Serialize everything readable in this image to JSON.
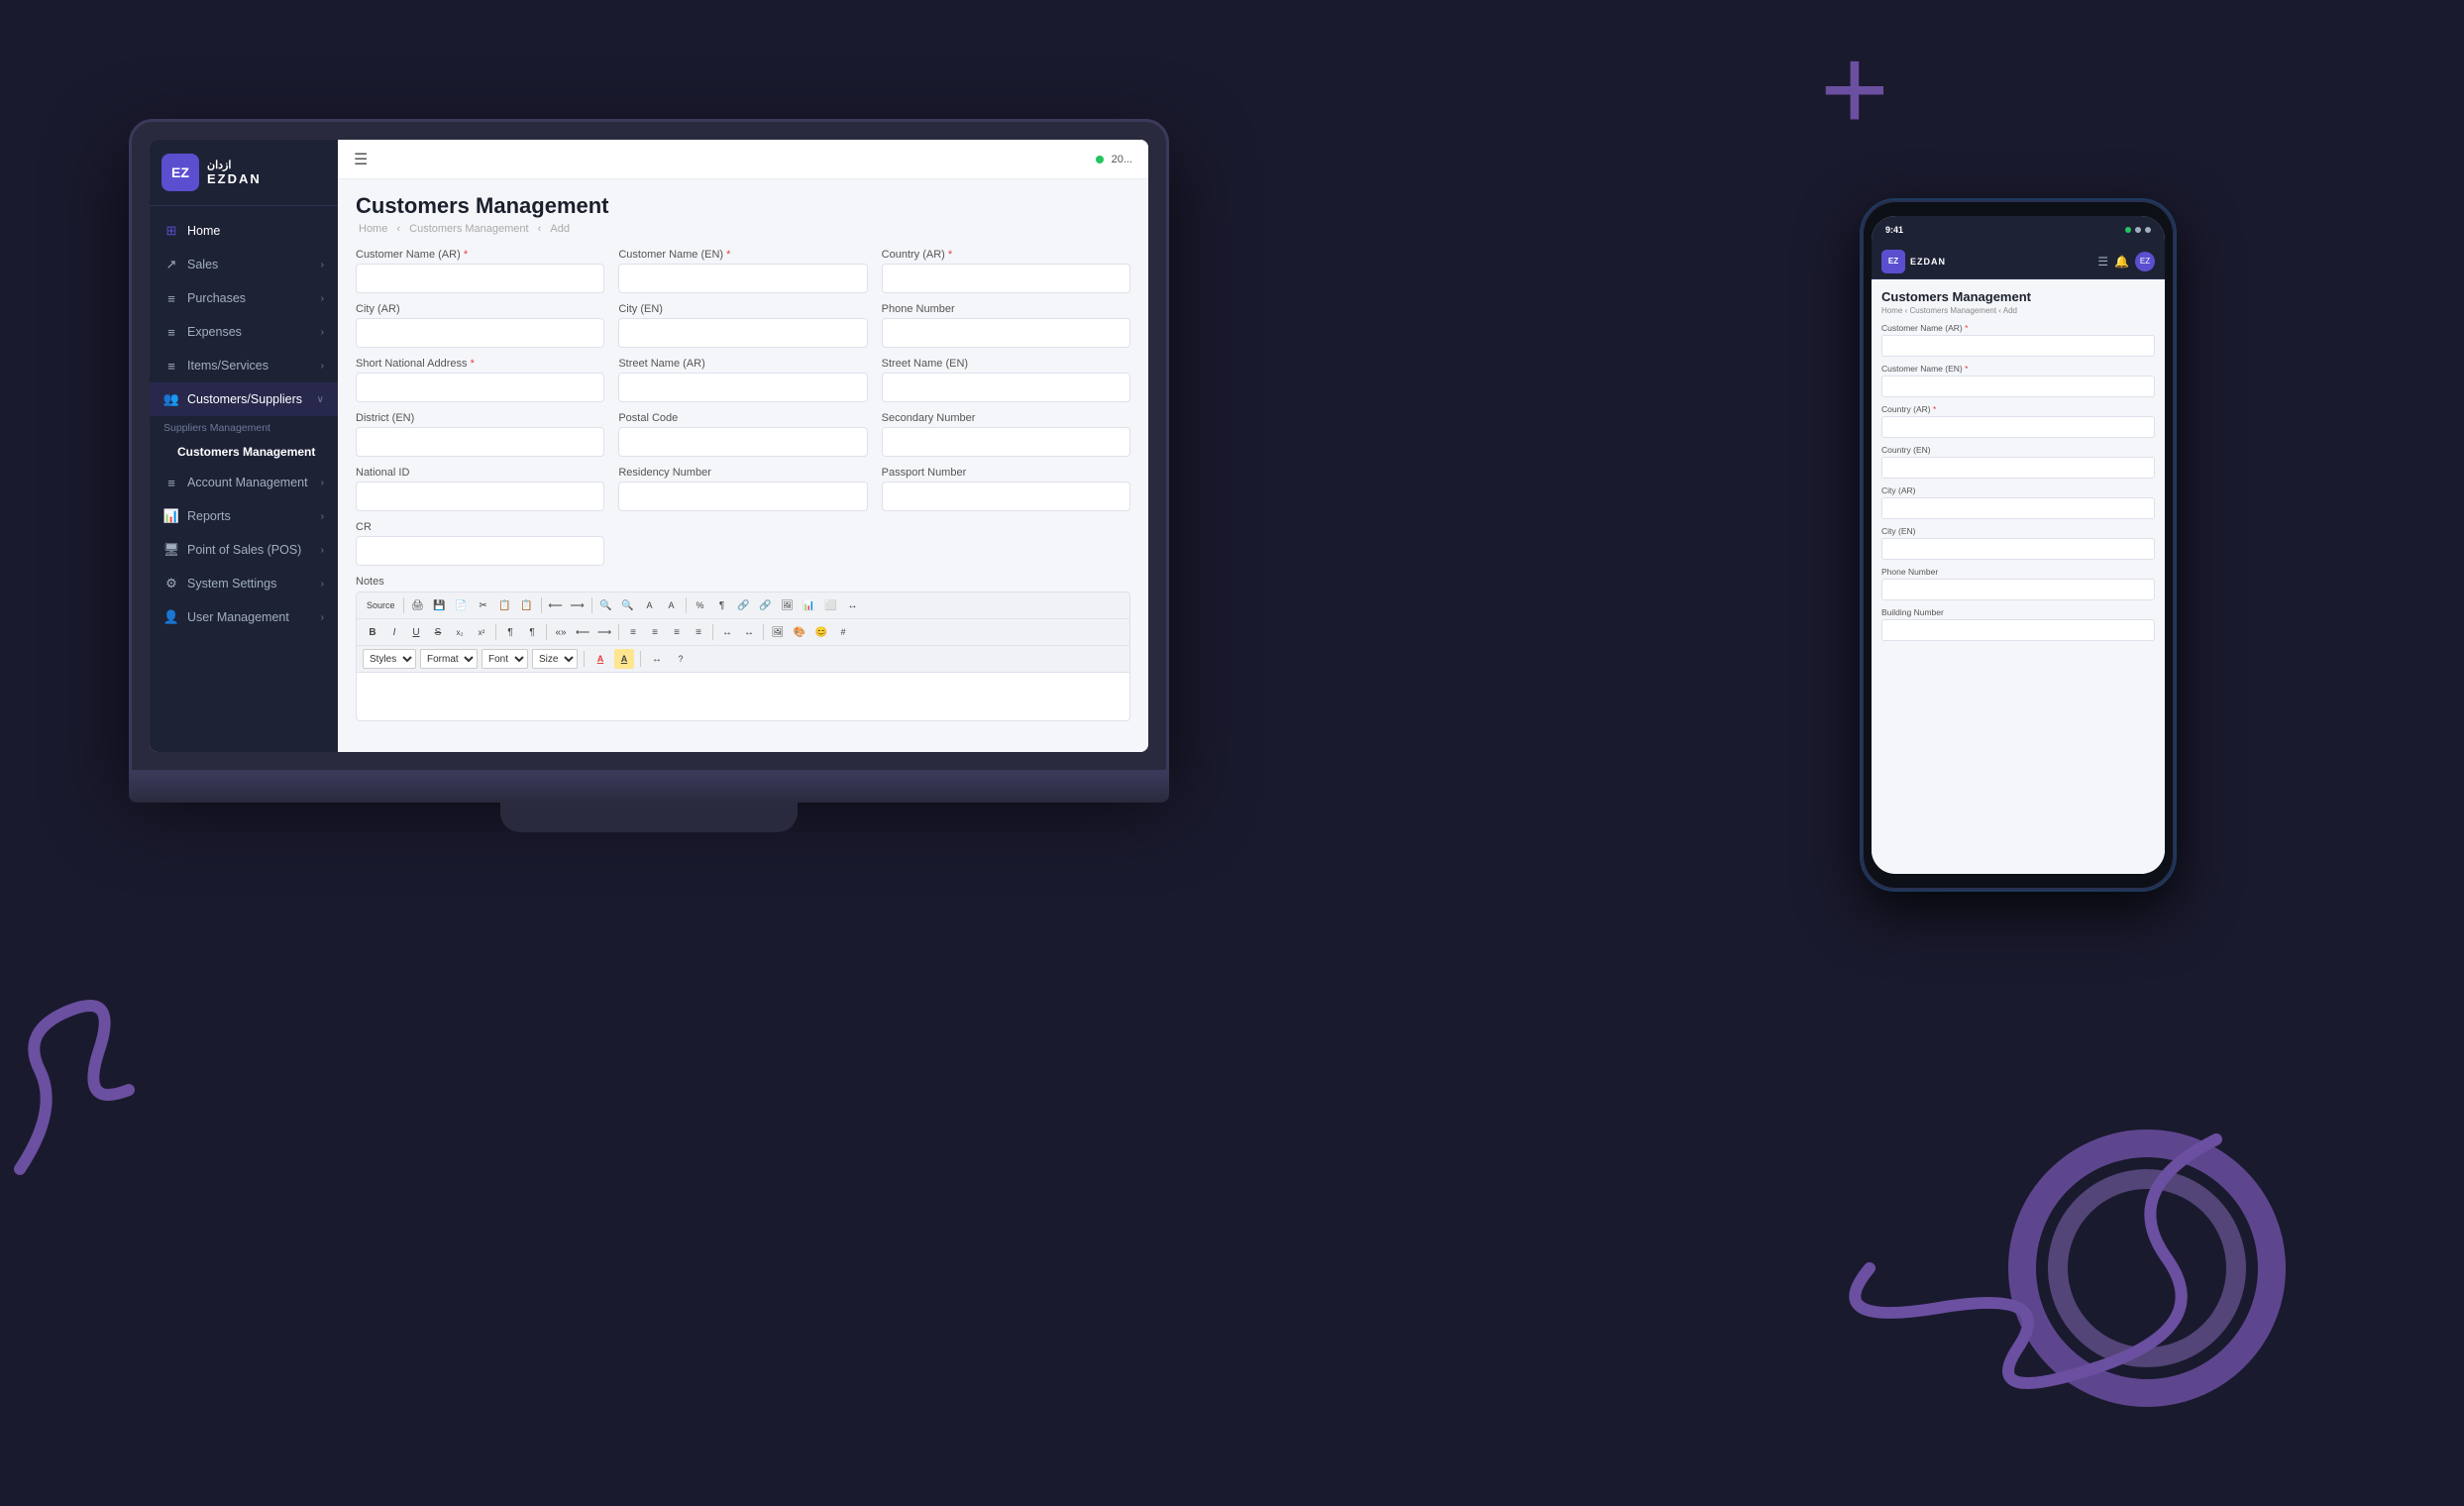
{
  "app": {
    "name": "EZDAN",
    "name_arabic": "ازدان",
    "logo_letters": "EZ"
  },
  "topbar": {
    "status_text": "20..."
  },
  "sidebar": {
    "items": [
      {
        "id": "home",
        "label": "Home",
        "icon": "⊞"
      },
      {
        "id": "sales",
        "label": "Sales",
        "icon": "↗",
        "has_arrow": true
      },
      {
        "id": "purchases",
        "label": "Purchases",
        "icon": "≡",
        "has_arrow": true
      },
      {
        "id": "expenses",
        "label": "Expenses",
        "icon": "≡",
        "has_arrow": true
      },
      {
        "id": "items-services",
        "label": "Items/Services",
        "icon": "≡",
        "has_arrow": true
      },
      {
        "id": "customers-suppliers",
        "label": "Customers/Suppliers",
        "icon": "👥",
        "has_arrow": true,
        "expanded": true
      }
    ],
    "submenu_label": "Suppliers Management",
    "subitems": [
      {
        "id": "customers-management",
        "label": "Customers Management",
        "active": true
      }
    ],
    "bottom_items": [
      {
        "id": "account-management",
        "label": "Account Management",
        "icon": "≡",
        "has_arrow": true
      },
      {
        "id": "reports",
        "label": "Reports",
        "icon": "📊",
        "has_arrow": true
      },
      {
        "id": "point-of-sales",
        "label": "Point of Sales (POS)",
        "icon": "🖥",
        "has_arrow": true
      },
      {
        "id": "system-settings",
        "label": "System Settings",
        "icon": "⚙",
        "has_arrow": true
      },
      {
        "id": "user-management",
        "label": "User Management",
        "icon": "👤",
        "has_arrow": true
      }
    ]
  },
  "page": {
    "title": "Customers Management",
    "breadcrumb": [
      "Home",
      "Customers Management",
      "Add"
    ]
  },
  "form": {
    "fields": [
      {
        "id": "customer-name-ar",
        "label": "Customer Name (AR)",
        "required": true,
        "col": 1
      },
      {
        "id": "customer-name-en",
        "label": "Customer Name (EN)",
        "required": true,
        "col": 2
      },
      {
        "id": "country-ar",
        "label": "Country (AR)",
        "required": true,
        "col": 3
      },
      {
        "id": "city-ar",
        "label": "City (AR)",
        "required": false,
        "col": 1
      },
      {
        "id": "city-en",
        "label": "City (EN)",
        "required": false,
        "col": 2
      },
      {
        "id": "phone-number",
        "label": "Phone Number",
        "required": false,
        "col": 3
      },
      {
        "id": "short-national-address",
        "label": "Short National Address",
        "required": true,
        "col": 1
      },
      {
        "id": "street-name-ar",
        "label": "Street Name (AR)",
        "required": false,
        "col": 2
      },
      {
        "id": "street-name-en",
        "label": "Street Name (EN)",
        "required": false,
        "col": 3
      },
      {
        "id": "district-en",
        "label": "District (EN)",
        "required": false,
        "col": 1
      },
      {
        "id": "postal-code",
        "label": "Postal Code",
        "required": false,
        "col": 2
      },
      {
        "id": "secondary-number",
        "label": "Secondary Number",
        "required": false,
        "col": 3
      },
      {
        "id": "national-id",
        "label": "National ID",
        "required": false,
        "col": 1
      },
      {
        "id": "residency-number",
        "label": "Residency Number",
        "required": false,
        "col": 2
      },
      {
        "id": "passport-number",
        "label": "Passport Number",
        "required": false,
        "col": 3
      },
      {
        "id": "cr",
        "label": "CR",
        "required": false,
        "col": 1
      }
    ],
    "notes_label": "Notes",
    "editor": {
      "toolbar_row1": [
        "Source",
        "📄",
        "💾",
        "🖨",
        "📋",
        "✂",
        "📋",
        "📋",
        "⟵",
        "⟶",
        "🔍",
        "🔍",
        "A",
        "A",
        "%",
        "¶",
        "🔗",
        "🔗",
        "🖼",
        "📊",
        "⬜",
        "↔",
        "🔗",
        "🔧"
      ],
      "toolbar_row2": [
        "B",
        "I",
        "U",
        "S",
        "x₂",
        "x²",
        "𝑓",
        "𝑓𝑖",
        "¶",
        "¶",
        "«»",
        "«»",
        "⟵",
        "⟶",
        "↔",
        "↔",
        "≡",
        "≡",
        "≡",
        "≡",
        "≡",
        "🖼",
        "🎨",
        "😊",
        "#"
      ],
      "toolbar_row3_selects": [
        "Styles",
        "Format",
        "Font",
        "Size"
      ],
      "format_label": "Format"
    }
  },
  "mobile": {
    "page_title": "Customers Management",
    "breadcrumb": [
      "Home",
      "Customers Management",
      "Add"
    ],
    "fields": [
      {
        "id": "m-customer-name-ar",
        "label": "Customer Name (AR)",
        "required": true
      },
      {
        "id": "m-customer-name-en",
        "label": "Customer Name (EN)",
        "required": true
      },
      {
        "id": "m-country-ar",
        "label": "Country (AR)",
        "required": true
      },
      {
        "id": "m-country-en",
        "label": "Country (EN)",
        "required": false
      },
      {
        "id": "m-city-ar",
        "label": "City (AR)",
        "required": false
      },
      {
        "id": "m-city-en",
        "label": "City (EN)",
        "required": false
      },
      {
        "id": "m-phone-number",
        "label": "Phone Number",
        "required": false
      },
      {
        "id": "m-building-number",
        "label": "Building Number",
        "required": false
      }
    ]
  }
}
